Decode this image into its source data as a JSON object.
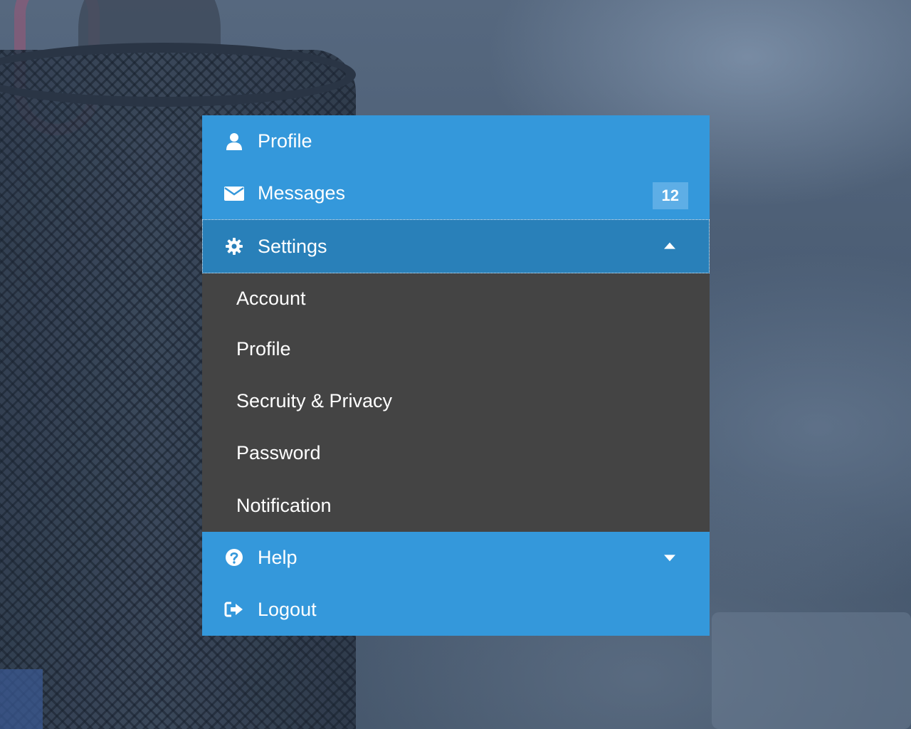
{
  "menu": {
    "items": [
      {
        "label": "Profile",
        "icon": "user-icon"
      },
      {
        "label": "Messages",
        "icon": "envelope-icon",
        "badge": "12"
      },
      {
        "label": "Settings",
        "icon": "gear-icon",
        "expanded": true
      },
      {
        "label": "Help",
        "icon": "question-circle-icon",
        "expanded": false
      },
      {
        "label": "Logout",
        "icon": "sign-out-icon"
      }
    ],
    "settings_submenu": [
      {
        "label": "Account"
      },
      {
        "label": "Profile"
      },
      {
        "label": "Secruity & Privacy"
      },
      {
        "label": "Password"
      },
      {
        "label": "Notification"
      }
    ]
  },
  "colors": {
    "menu_blue": "#3498db",
    "menu_blue_active": "#2980b9",
    "submenu_bg": "#444444",
    "badge_bg": "#5eaee6",
    "text": "#ffffff"
  }
}
